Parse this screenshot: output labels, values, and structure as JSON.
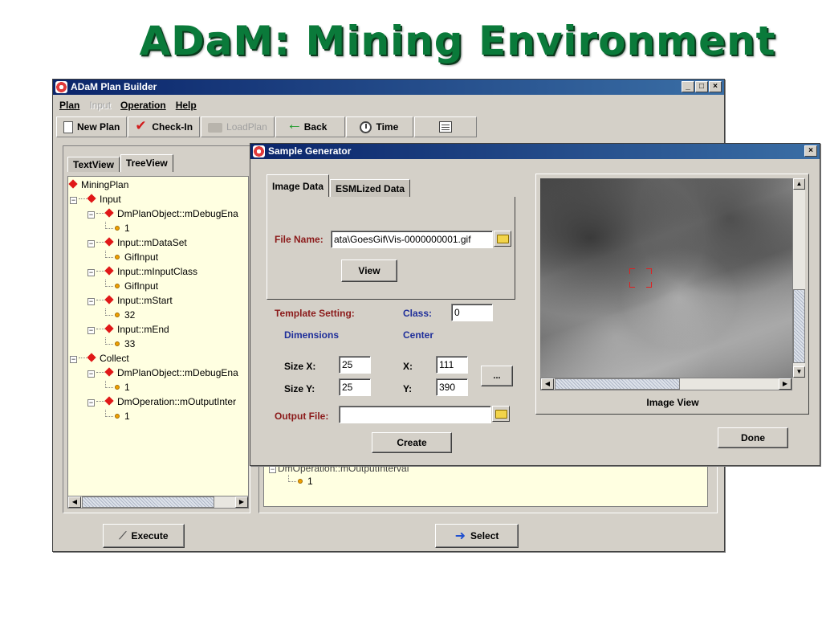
{
  "slide": {
    "title": "ADaM: Mining Environment"
  },
  "plan_builder": {
    "title": "ADaM Plan Builder",
    "window_buttons": [
      "_",
      "□",
      "×"
    ],
    "menu": [
      {
        "label": "Plan",
        "enabled": true
      },
      {
        "label": "Input",
        "enabled": false
      },
      {
        "label": "Operation",
        "enabled": true
      },
      {
        "label": "Help",
        "enabled": true
      }
    ],
    "toolbar": {
      "new_plan": "New Plan",
      "check_in": "Check-In",
      "load_plan": "LoadPlan",
      "back": "Back",
      "time": "Time"
    },
    "tabs": {
      "text_view": "TextView",
      "tree_view": "TreeView"
    },
    "tree": [
      "MiningPlan",
      "Input",
      "DmPlanObject::mDebugEna",
      "1",
      "Input::mDataSet",
      "GifInput",
      "Input::mInputClass",
      "GifInput",
      "Input::mStart",
      "32",
      "Input::mEnd",
      "33",
      "Collect",
      "DmPlanObject::mDebugEna",
      "1",
      "DmOperation::mOutputInter",
      "1"
    ],
    "right_tree": [
      "DmOperation::mOutputInterval",
      "1"
    ],
    "execute_button": "Execute",
    "select_button": "Select"
  },
  "sample_generator": {
    "title": "Sample Generator",
    "close_button": "×",
    "tabs": {
      "image_data": "Image Data",
      "esmlized_data": "ESMLized Data"
    },
    "file_name_label": "File Name:",
    "file_name_value": "ata\\GoesGif\\Vis-0000000001.gif",
    "view_button": "View",
    "template_setting_label": "Template Setting:",
    "class_label": "Class:",
    "class_value": "0",
    "dimensions_label": "Dimensions",
    "center_label": "Center",
    "size_x_label": "Size X:",
    "size_x_value": "25",
    "size_y_label": "Size Y:",
    "size_y_value": "25",
    "x_label": "X:",
    "x_value": "111",
    "y_label": "Y:",
    "y_value": "390",
    "ellipsis_button": "...",
    "output_file_label": "Output File:",
    "output_file_value": "",
    "create_button": "Create",
    "image_view_label": "Image View",
    "done_button": "Done"
  },
  "colors": {
    "title_green": "#0a7a3a",
    "titlebar_start": "#0a246a",
    "titlebar_end": "#3a6ea5",
    "tree_background": "#ffffe1",
    "label_red": "#8b1a1a",
    "label_blue": "#1f2f9a",
    "node_red": "#e01818"
  }
}
